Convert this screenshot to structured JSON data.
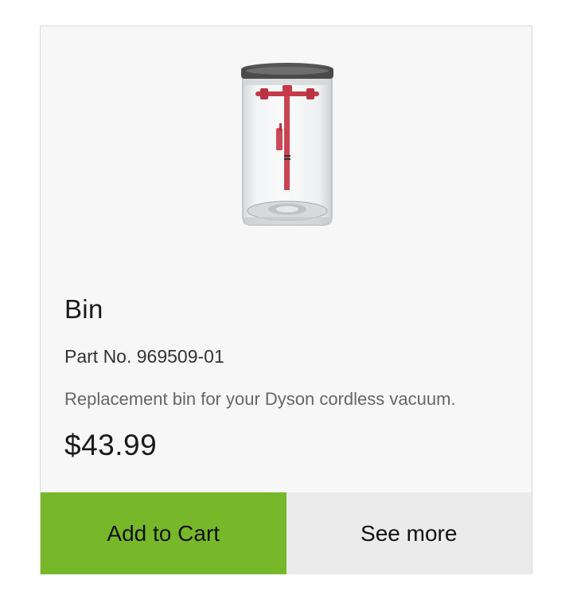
{
  "product": {
    "image_icon": "dust-bin-icon",
    "title": "Bin",
    "part_number": "Part No. 969509-01",
    "description": "Replacement bin for your Dyson cordless vacuum.",
    "price": "$43.99"
  },
  "actions": {
    "add_to_cart_label": "Add to Cart",
    "see_more_label": "See more"
  },
  "colors": {
    "add_to_cart_bg": "#77b82a",
    "see_more_bg": "#ebebeb",
    "card_bg": "#f7f7f7"
  }
}
